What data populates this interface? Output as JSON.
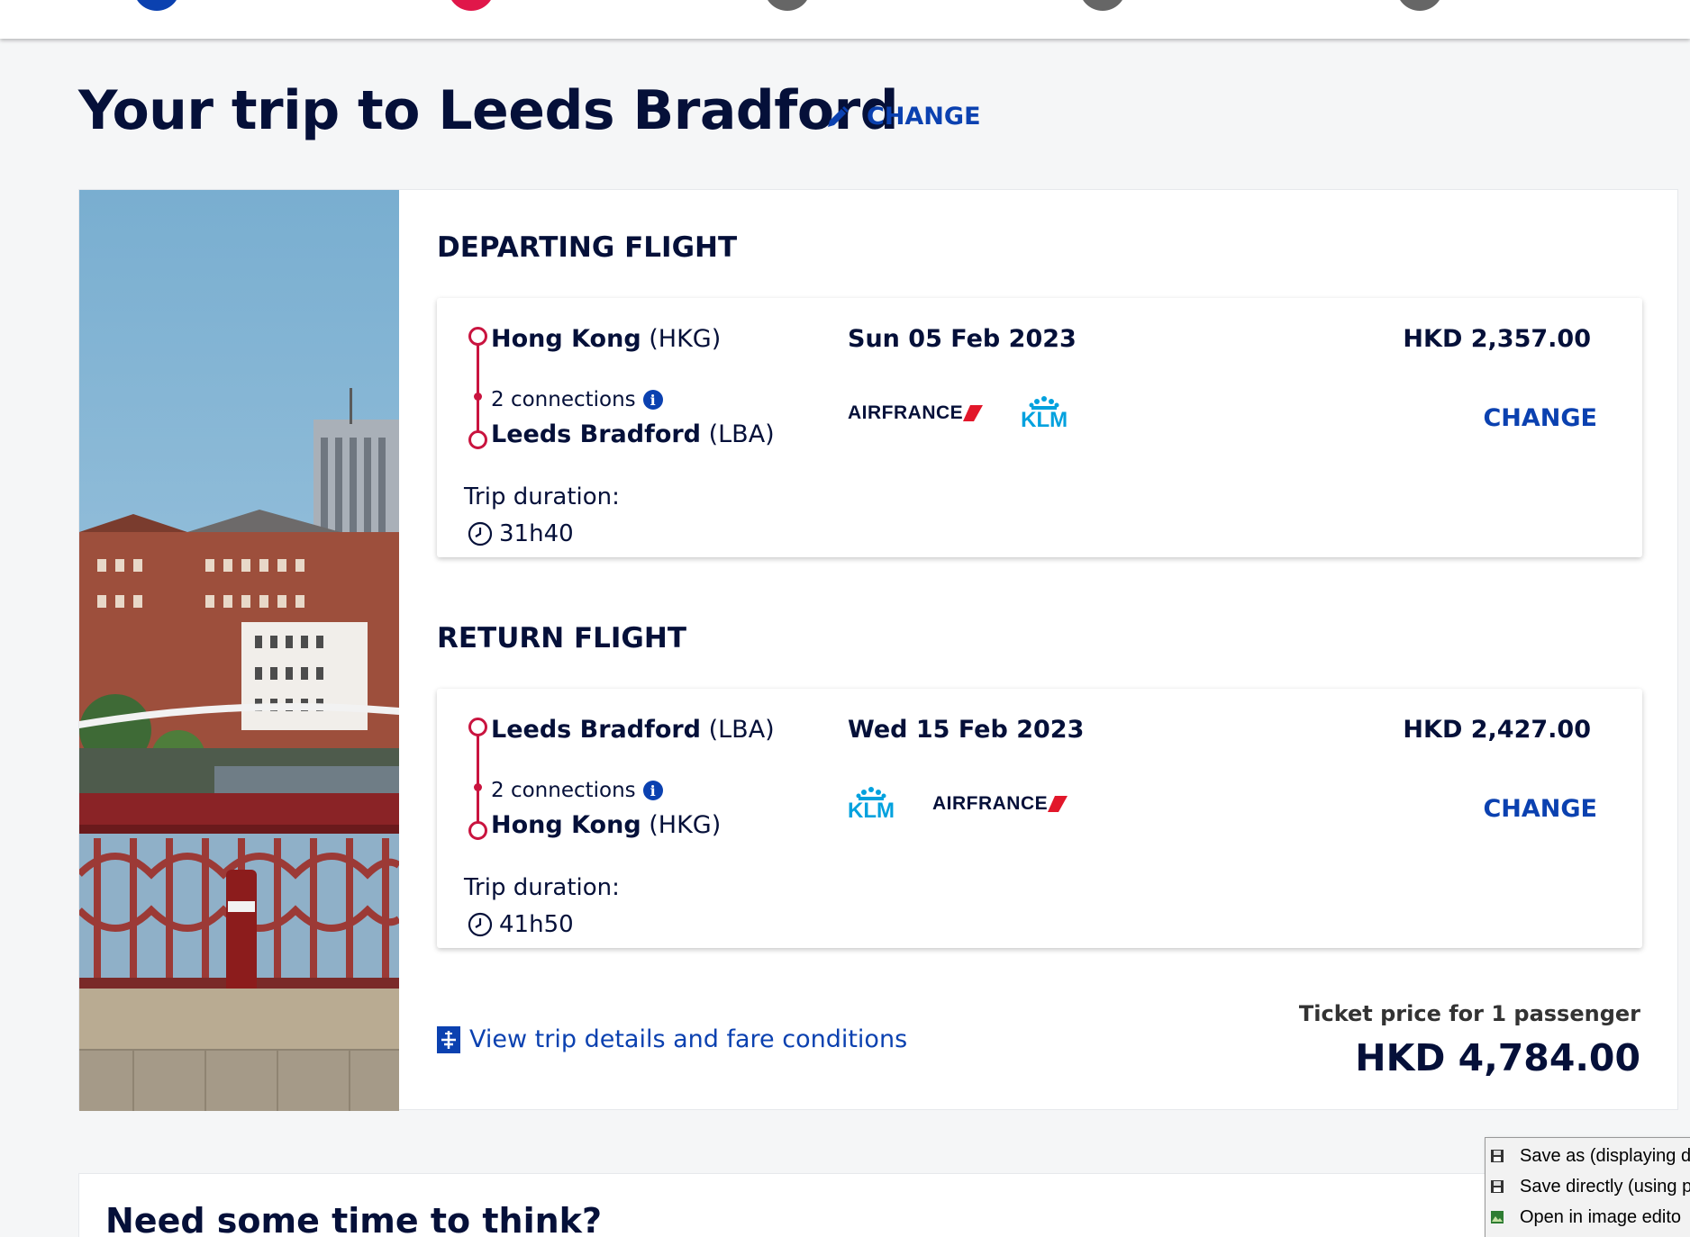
{
  "header": {
    "steps": [
      {
        "color": "#0b41b0"
      },
      {
        "color": "#e0174a"
      },
      {
        "color": "#666666"
      },
      {
        "color": "#666666"
      },
      {
        "color": "#666666"
      }
    ]
  },
  "page": {
    "title": "Your trip to Leeds Bradford",
    "change_label": "CHANGE"
  },
  "departing": {
    "heading": "DEPARTING FLIGHT",
    "origin_name": "Hong Kong",
    "origin_code": "(HKG)",
    "connections": "2 connections",
    "destination_name": "Leeds Bradford",
    "destination_code": "(LBA)",
    "duration_label": "Trip duration:",
    "duration": "31h40",
    "date": "Sun 05 Feb 2023",
    "airlines": [
      "AIRFRANCE",
      "KLM"
    ],
    "price": "HKD 2,357.00",
    "change_label": "CHANGE"
  },
  "return": {
    "heading": "RETURN FLIGHT",
    "origin_name": "Leeds Bradford",
    "origin_code": "(LBA)",
    "connections": "2 connections",
    "destination_name": "Hong Kong",
    "destination_code": "(HKG)",
    "duration_label": "Trip duration:",
    "duration": "41h50",
    "date": "Wed 15 Feb 2023",
    "airlines": [
      "KLM",
      "AIRFRANCE"
    ],
    "price": "HKD 2,427.00",
    "change_label": "CHANGE"
  },
  "summary": {
    "details_link": "View trip details and fare conditions",
    "ticket_label": "Ticket price for 1 passenger",
    "total": "HKD 4,784.00"
  },
  "think": {
    "title": "Need some time to think?"
  },
  "context_menu": {
    "items": [
      {
        "label": "Save as (displaying d",
        "icon": "floppy-disk-icon"
      },
      {
        "label": "Save directly (using p",
        "icon": "floppy-disk-icon"
      },
      {
        "label": "Open in image edito",
        "icon": "image-editor-icon"
      }
    ]
  },
  "colors": {
    "navy": "#051039",
    "link_blue": "#0b41b0",
    "route_red": "#c9143f",
    "klm_blue": "#00a1de",
    "af_red": "#e2172a"
  }
}
